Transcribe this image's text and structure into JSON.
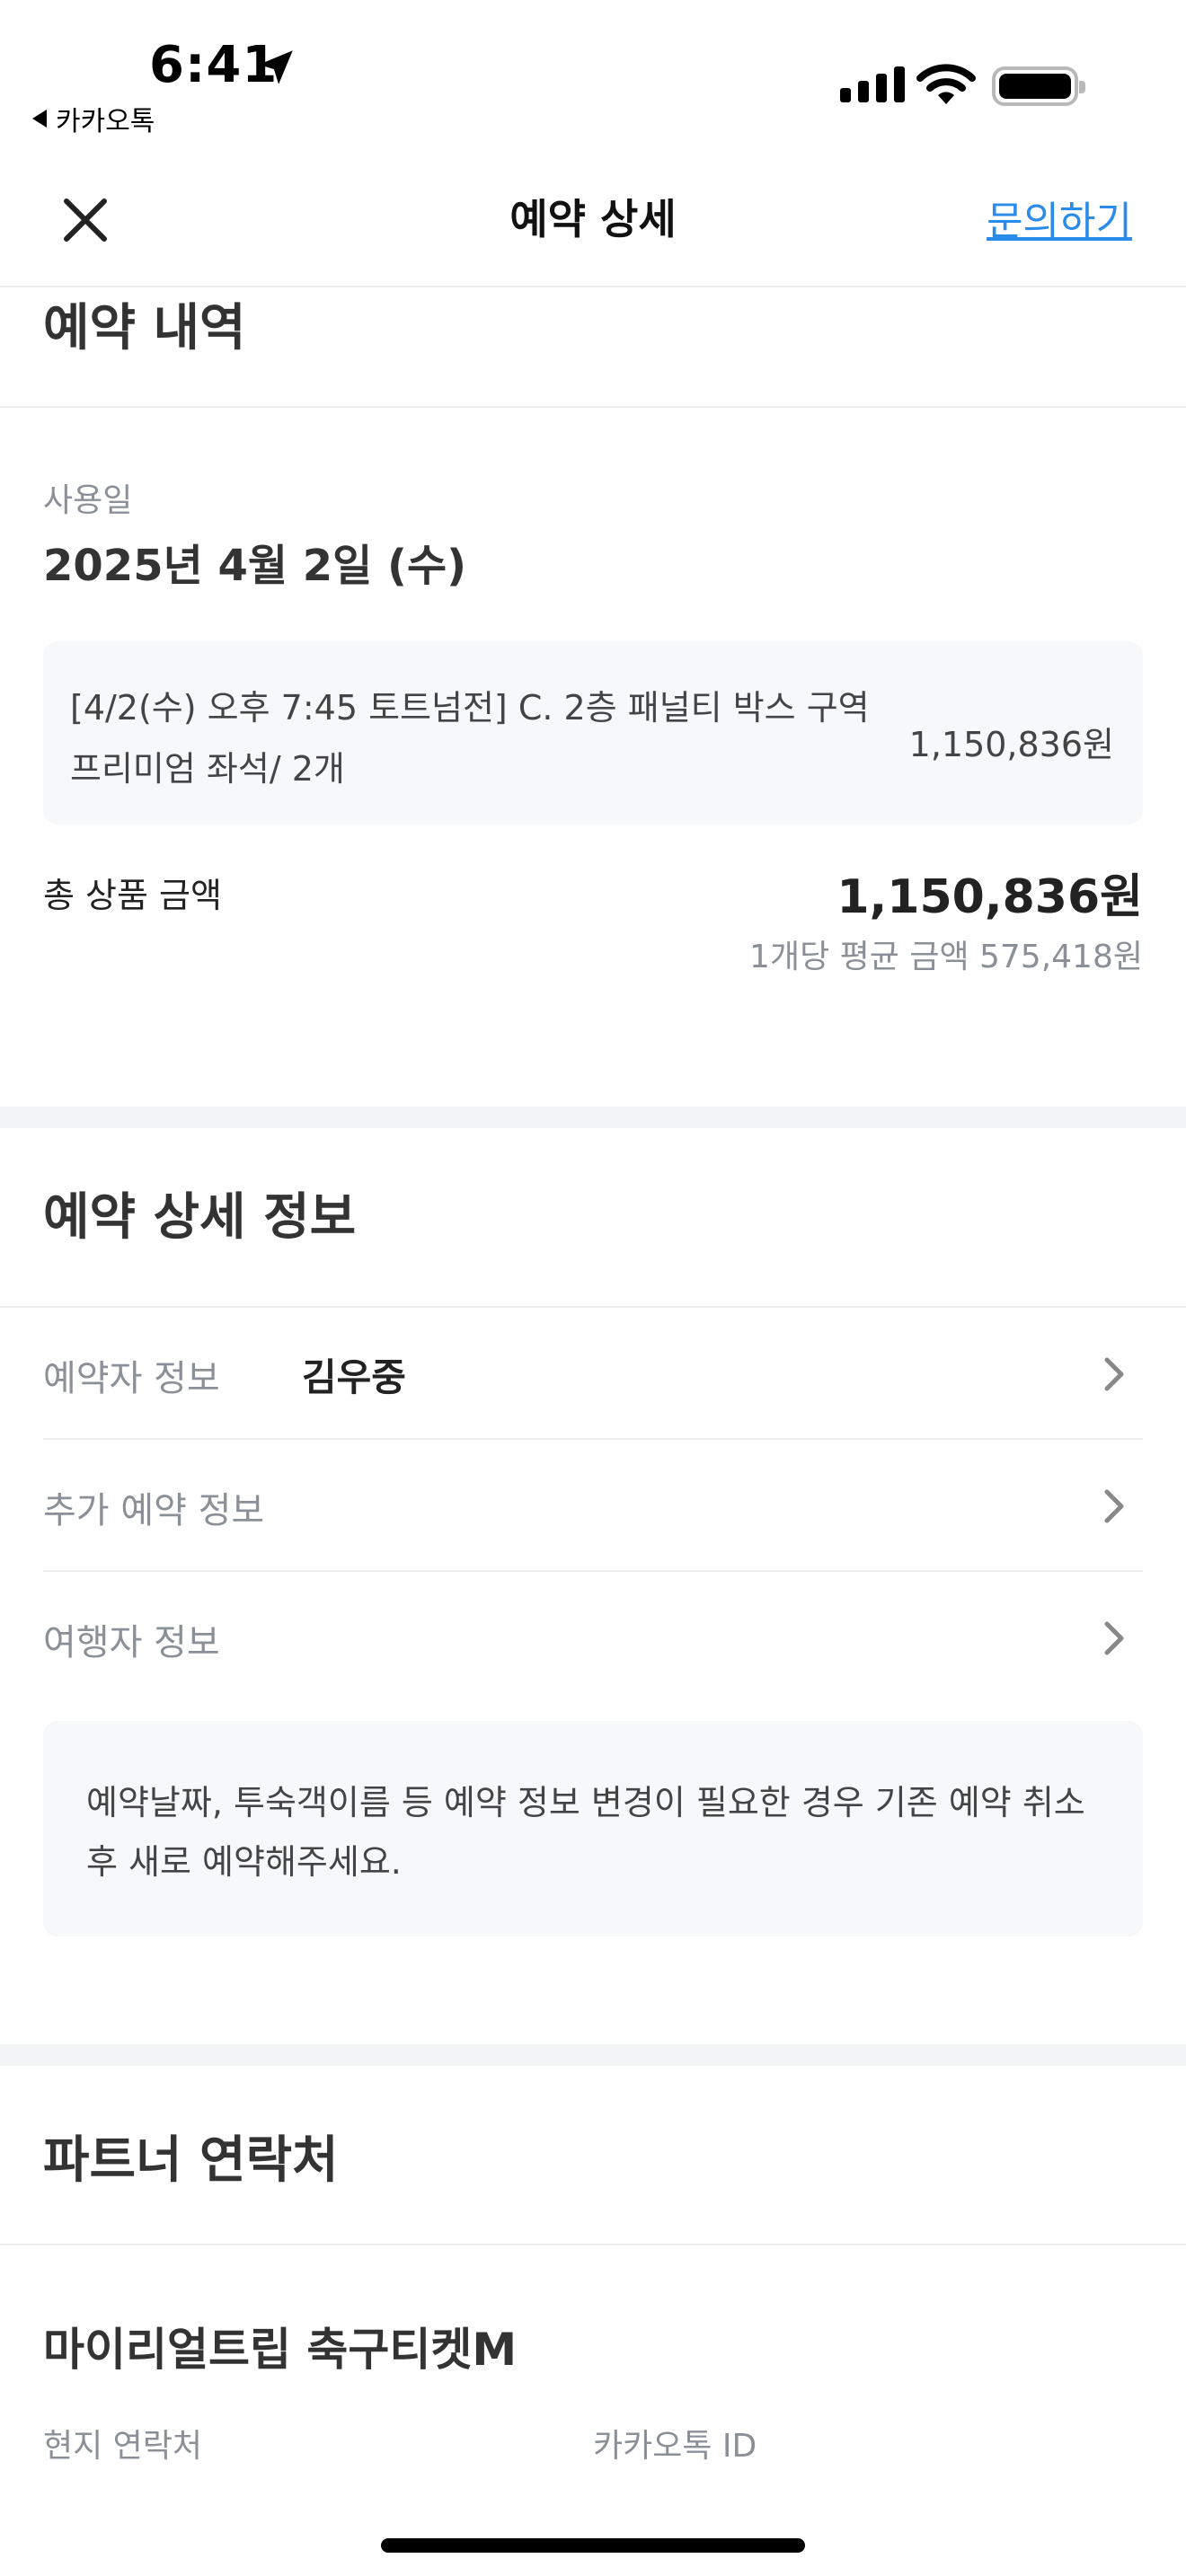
{
  "status_bar": {
    "time": "6:41",
    "back_app": "카카오톡"
  },
  "navbar": {
    "title": "예약 상세",
    "inquiry_link": "문의하기"
  },
  "booking": {
    "section_title": "예약 내역",
    "use_date_label": "사용일",
    "use_date": "2025년 4월 2일 (수)",
    "item_name": "[4/2(수) 오후 7:45 토트넘전] C. 2층 패널티 박스 구역 프리미엄 좌석/ 2개",
    "item_price": "1,150,836원",
    "total_label": "총 상품 금액",
    "total_value": "1,150,836원",
    "avg_price": "1개당 평균 금액 575,418원"
  },
  "details": {
    "section_title": "예약 상세 정보",
    "rows": [
      {
        "label": "예약자 정보",
        "value": "김우중"
      },
      {
        "label": "추가 예약 정보",
        "value": ""
      },
      {
        "label": "여행자 정보",
        "value": ""
      }
    ],
    "notice": "예약날짜, 투숙객이름 등 예약 정보 변경이 필요한 경우 기존 예약 취소 후 새로 예약해주세요."
  },
  "partner": {
    "section_title": "파트너 연락처",
    "name": "마이리얼트립 축구티켓M",
    "local_contact_label": "현지 연락처",
    "kakao_id_label": "카카오톡 ID"
  },
  "colors": {
    "link": "#2a8be8",
    "muted_text": "#8b9098",
    "box_background": "#f7f8fa",
    "section_band": "#f3f4f6"
  }
}
